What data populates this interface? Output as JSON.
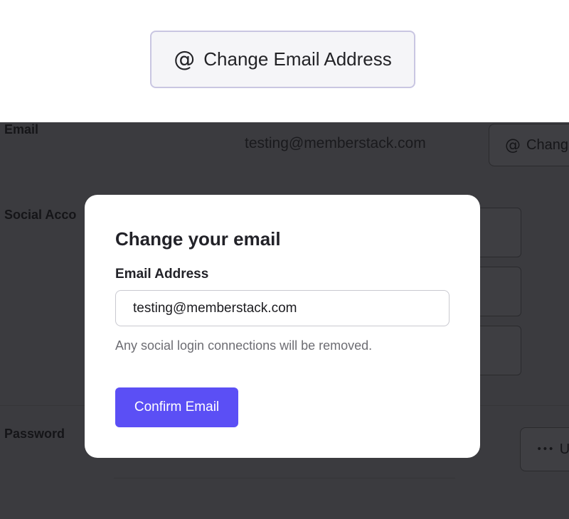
{
  "top_button": {
    "icon": "at-icon",
    "icon_glyph": "@",
    "label": "Change Email Address"
  },
  "background": {
    "email_label": "Email",
    "email_value": "testing@memberstack.com",
    "change_button_icon_glyph": "@",
    "change_button_label": "Chang",
    "social_label": "Social Acco",
    "password_label": "Password",
    "update_button_icon_glyph": "•••",
    "update_button_label": "U"
  },
  "modal": {
    "title": "Change your email",
    "field_label": "Email Address",
    "email_value": "testing@memberstack.com",
    "helper_text": "Any social login connections will be removed.",
    "confirm_label": "Confirm Email"
  },
  "colors": {
    "accent": "#5b4ff5",
    "overlay": "#3b3b3f",
    "top_button_border": "#c9c6e2"
  }
}
